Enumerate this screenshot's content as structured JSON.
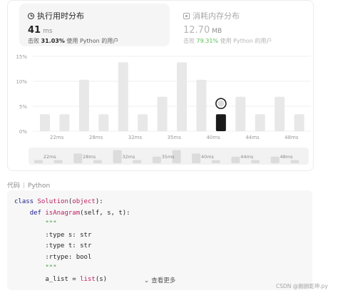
{
  "runtime_card": {
    "title": "执行用时分布",
    "icon": "clock-icon",
    "value": "41",
    "unit": "ms",
    "beats_prefix": "击败",
    "beats_pct": "31.03%",
    "beats_suffix": "使用 Python 的用户"
  },
  "memory_card": {
    "title": "消耗内存分布",
    "icon": "chip-icon",
    "value": "12.70",
    "unit": "MB",
    "beats_prefix": "击败",
    "beats_pct": "79.31%",
    "beats_suffix": "使用 Python 的用户"
  },
  "chart_data": {
    "type": "bar",
    "title": "",
    "xlabel": "",
    "ylabel": "",
    "ylim": [
      0,
      15
    ],
    "y_ticks": [
      "0%",
      "5%",
      "10%",
      "15%"
    ],
    "x_tick_labels": [
      "22ms",
      "28ms",
      "32ms",
      "35ms",
      "40ms",
      "44ms",
      "48ms"
    ],
    "values": [
      3.4,
      3.4,
      10.3,
      3.4,
      13.8,
      3.4,
      6.9,
      13.8,
      10.3,
      3.4,
      6.9,
      3.4,
      6.9,
      3.4
    ],
    "highlight_index": 9,
    "highlight_color": "#1a1a1a",
    "bar_color": "#e8e8e8",
    "grid": true,
    "overview_tick_labels": [
      "22ms",
      "28ms",
      "32ms",
      "35ms",
      "40ms",
      "44ms",
      "48ms"
    ]
  },
  "code_section": {
    "label": "代码",
    "language": "Python",
    "see_more": "查看更多"
  },
  "watermark": "CSDN @朗朗乾坤.py",
  "colors": {
    "accent_green": "#5bbf58",
    "highlight_bar": "#1a1a1a"
  }
}
